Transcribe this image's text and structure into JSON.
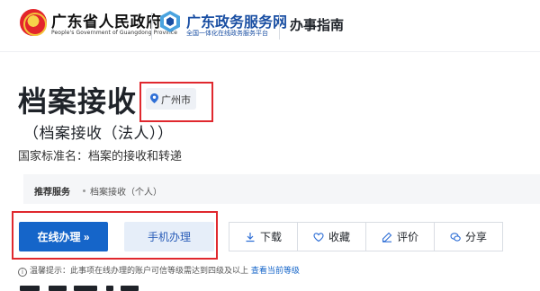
{
  "header": {
    "gov_name": "广东省人民政府",
    "gov_name_en": "People's Government of Guangdong Province",
    "service_name": "广东政务服务网",
    "service_sub": "全国一体化在线政务服务平台",
    "guide_label": "办事指南"
  },
  "item": {
    "title": "档案接收",
    "location": "广州市",
    "subtitle": "（档案接收（法人））",
    "standard_name": "国家标准名：档案的接收和转递"
  },
  "recommend": {
    "label": "推荐服务",
    "item": "档案接收（个人）"
  },
  "actions": {
    "online": "在线办理 »",
    "mobile": "手机办理",
    "download": "下载",
    "favorite": "收藏",
    "evaluate": "评价",
    "share": "分享"
  },
  "tip": {
    "text": "温馨提示：此事项在线办理的账户可信等级需达到四级及以上",
    "link": "查看当前等级"
  },
  "colors": {
    "primary": "#1565c9",
    "highlight_border": "#e0282e",
    "service_blue": "#1a4fa3"
  }
}
